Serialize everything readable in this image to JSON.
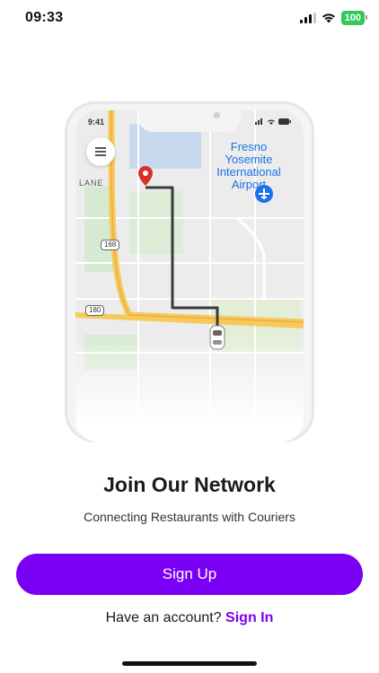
{
  "status_bar": {
    "time": "09:33",
    "battery": "100"
  },
  "illustration": {
    "phone_time": "9:41",
    "map_labels": {
      "airport": "Fresno\nYosemite\nInternational\nAirport",
      "lane": "LANE",
      "hwy_168": "168",
      "hwy_180": "180"
    }
  },
  "content": {
    "title": "Join Our Network",
    "subtitle": "Connecting Restaurants with Couriers",
    "signup_label": "Sign Up",
    "account_prompt": "Have an account?",
    "signin_label": "Sign In"
  },
  "colors": {
    "accent": "#7a00f5",
    "battery": "#34c759",
    "map_route": "#3a3a3a",
    "pin": "#d93025"
  }
}
